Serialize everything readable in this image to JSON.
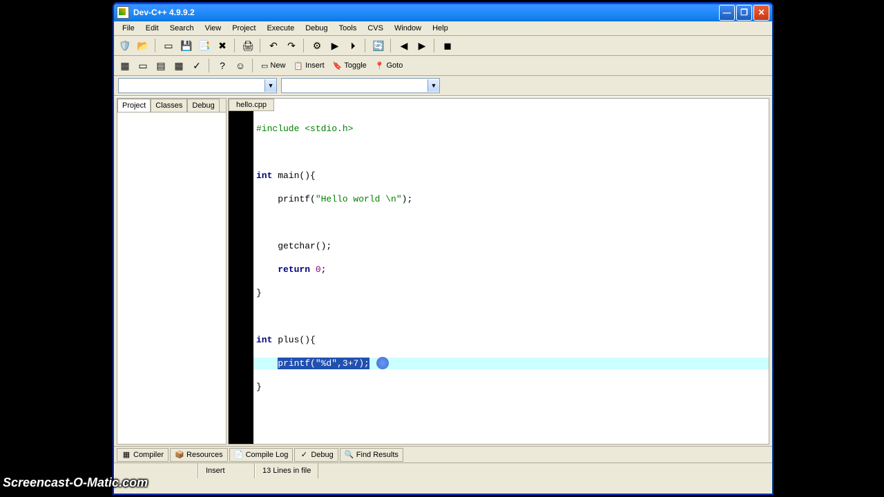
{
  "title": "Dev-C++ 4.9.9.2",
  "menu": [
    "File",
    "Edit",
    "Search",
    "View",
    "Project",
    "Execute",
    "Debug",
    "Tools",
    "CVS",
    "Window",
    "Help"
  ],
  "toolbar2": {
    "new": "New",
    "insert": "Insert",
    "toggle": "Toggle",
    "goto": "Goto"
  },
  "left_tabs": [
    "Project",
    "Classes",
    "Debug"
  ],
  "editor_tab": "hello.cpp",
  "code": {
    "l1_a": "#include ",
    "l1_b": "<stdio.h>",
    "l3_a": "int",
    "l3_b": " main(){",
    "l4_a": "    printf(",
    "l4_b": "\"Hello world \\n\"",
    "l4_c": ");",
    "l6": "    getchar();",
    "l7_a": "    ",
    "l7_b": "return",
    "l7_c": " ",
    "l7_d": "0",
    "l7_e": ";",
    "l8": "}",
    "l10_a": "int",
    "l10_b": " plus(){",
    "l11_sel": "printf(\"%d\",3+7);",
    "l12": "}"
  },
  "bottom_tabs": [
    "Compiler",
    "Resources",
    "Compile Log",
    "Debug",
    "Find Results"
  ],
  "status": {
    "mode": "Insert",
    "lines": "13 Lines in file"
  },
  "watermark": "Screencast-O-Matic.com"
}
